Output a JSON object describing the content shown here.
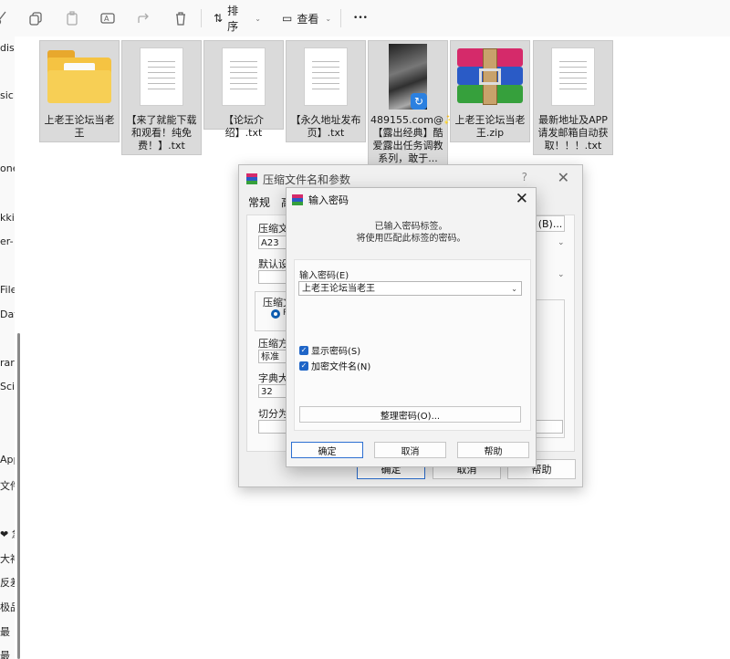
{
  "toolbar": {
    "sort_label": "排序",
    "view_label": "查看",
    "more_label": "•••"
  },
  "nav": {
    "items": [
      "dis",
      "sic",
      "one",
      "kki",
      "er-",
      "File",
      "Dat",
      "rar",
      "Sci",
      "App",
      "文件",
      "❤ 急",
      "大神",
      "反差",
      "极品",
      "最",
      "最"
    ]
  },
  "files": [
    {
      "name": "上老王论坛当老王",
      "kind": "folder"
    },
    {
      "name": "【来了就能下载和观看！纯免费！】.txt",
      "kind": "txt"
    },
    {
      "name": "【论坛介绍】.txt",
      "kind": "txt"
    },
    {
      "name": "【永久地址发布页】.txt",
      "kind": "txt"
    },
    {
      "name": "489155.com@✨【露出经典】酷爱露出任务调教系列，敢于...",
      "kind": "video"
    },
    {
      "name": "上老王论坛当老王.zip",
      "kind": "zip"
    },
    {
      "name": "最新地址及APP请发邮箱自动获取！！！.txt",
      "kind": "txt"
    }
  ],
  "winrar_dialog": {
    "title": "压缩文件名和参数",
    "help_glyph": "?",
    "close_glyph": "✕",
    "tabs": [
      "常规",
      "高"
    ],
    "archive_name_label": "压缩文件",
    "archive_name_value": "A23",
    "browse_label": "(B)...",
    "default_label": "默认设置",
    "format_label": "压缩文",
    "radio_glyph": "R",
    "method_label": "压缩方",
    "method_value": "标准",
    "dict_label": "字典大小",
    "dict_value": "32",
    "split_label": "切分为",
    "ok_label": "确定",
    "cancel_label": "取消",
    "help_label": "帮助"
  },
  "password_dialog": {
    "title": "输入密码",
    "close_glyph": "✕",
    "info_line1": "已输入密码标签。",
    "info_line2": "将使用匹配此标签的密码。",
    "password_label": "输入密码(E)",
    "password_value": "上老王论坛当老王",
    "show_password_label": "显示密码(S)",
    "encrypt_names_label": "加密文件名(N)",
    "organize_label": "整理密码(O)...",
    "ok_label": "确定",
    "cancel_label": "取消",
    "help_label": "帮助"
  },
  "colors": {
    "accent": "#1f65c7",
    "folder": "#f5c342",
    "selected_tile": "#dadada"
  }
}
